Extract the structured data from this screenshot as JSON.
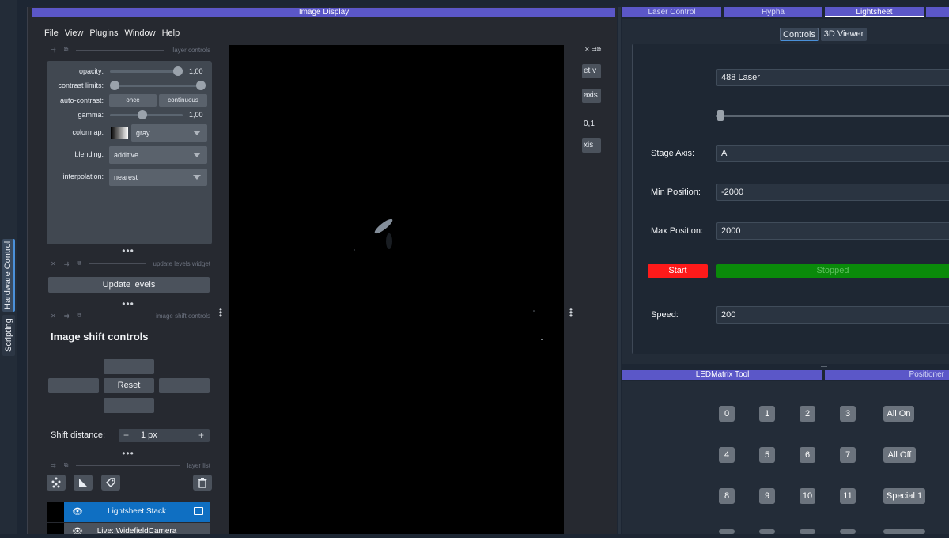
{
  "sidebar": {
    "tabs": [
      "Hardware Control",
      "Scripting"
    ]
  },
  "image_display": {
    "title": "Image Display",
    "menu": [
      "File",
      "View",
      "Plugins",
      "Window",
      "Help"
    ],
    "layer_controls": {
      "header": "layer controls",
      "opacity_label": "opacity:",
      "opacity_value": "1,00",
      "opacity_level": 1.0,
      "contrast_label": "contrast limits:",
      "auto_contrast_label": "auto-contrast:",
      "once_label": "once",
      "continuous_label": "continuous",
      "gamma_label": "gamma:",
      "gamma_value": "1,00",
      "colormap_label": "colormap:",
      "colormap_value": "gray",
      "blending_label": "blending:",
      "blending_value": "additive",
      "interpolation_label": "interpolation:",
      "interpolation_value": "nearest"
    },
    "update_levels": {
      "header": "update levels widget",
      "button": "Update levels"
    },
    "image_shift": {
      "header": "image shift controls",
      "title": "Image shift controls",
      "reset_label": "Reset",
      "shift_distance_label": "Shift distance:",
      "shift_value": "1 px",
      "minus": "−",
      "plus": "+"
    },
    "layer_list": {
      "header": "layer list",
      "layers": [
        {
          "name": "Lightsheet Stack",
          "selected": true
        },
        {
          "name": "Live: WidefieldCamera",
          "selected": false
        }
      ]
    },
    "right_strip": [
      "et v",
      "axis",
      "0,1",
      "xis"
    ]
  },
  "right_tabs": [
    "Laser Control",
    "Hypha",
    "Lightsheet"
  ],
  "lightsheet": {
    "subtabs": [
      "Controls",
      "3D Viewer"
    ],
    "laser_select": "488 Laser",
    "slider_level": 0.0,
    "stage_axis_label": "Stage Axis:",
    "stage_axis_value": "A",
    "min_pos_label": "Min Position:",
    "min_pos_value": "-2000",
    "max_pos_label": "Max Position:",
    "max_pos_value": "2000",
    "start_label": "Start",
    "status_label": "Stopped",
    "speed_label": "Speed:",
    "speed_value": "200",
    "start_color": "#ff1a1a",
    "status_color": "#0a8a0a"
  },
  "bottom_tabs": [
    "LEDMatrix Tool",
    "Positioner"
  ],
  "led_matrix": {
    "rows": [
      {
        "buttons": [
          "0",
          "1",
          "2",
          "3"
        ],
        "action": "All On"
      },
      {
        "buttons": [
          "4",
          "5",
          "6",
          "7"
        ],
        "action": "All Off"
      },
      {
        "buttons": [
          "8",
          "9",
          "10",
          "11"
        ],
        "action": "Special 1"
      }
    ]
  }
}
